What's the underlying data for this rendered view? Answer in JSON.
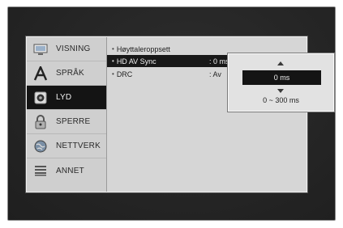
{
  "sidebar": {
    "items": [
      {
        "label": "VISNING",
        "icon": "monitor-icon",
        "active": false
      },
      {
        "label": "SPRÅK",
        "icon": "language-a-icon",
        "active": false
      },
      {
        "label": "LYD",
        "icon": "speaker-icon",
        "active": true
      },
      {
        "label": "SPERRE",
        "icon": "lock-icon",
        "active": false
      },
      {
        "label": "NETTVERK",
        "icon": "globe-icon",
        "active": false
      },
      {
        "label": "ANNET",
        "icon": "list-icon",
        "active": false
      }
    ]
  },
  "settings": {
    "bullet": "•",
    "rows": [
      {
        "label": "Høyttaleroppsett",
        "value": ""
      },
      {
        "label": "HD AV Sync",
        "value": ": 0 ms",
        "selected": true
      },
      {
        "label": "DRC",
        "value": ": Av"
      }
    ]
  },
  "popup": {
    "value": "0 ms",
    "range": "0 ~ 300 ms"
  },
  "colors": {
    "panel": "#d6d6d6",
    "highlight": "#141414",
    "background": "#242424"
  }
}
